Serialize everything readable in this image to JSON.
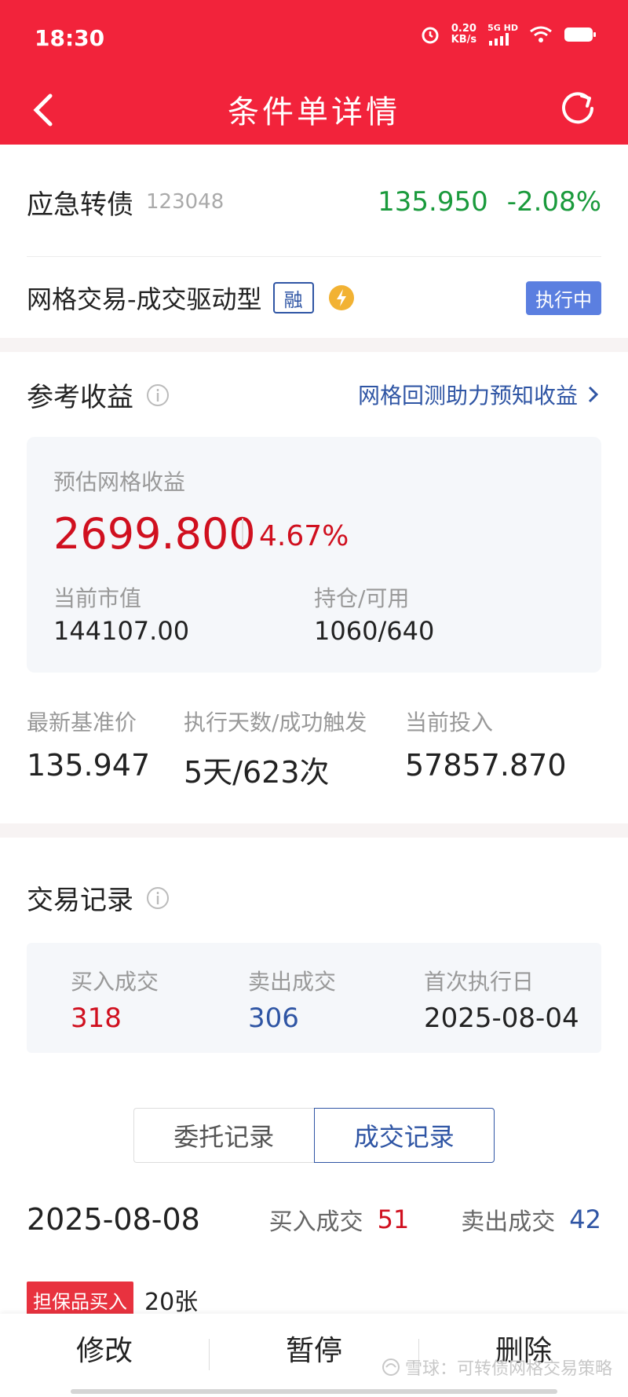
{
  "status_bar": {
    "time": "18:30",
    "net_speed": "0.20",
    "net_unit": "KB/s",
    "net_type": "5G HD",
    "icons": [
      "alarm-icon",
      "signal-icon",
      "wifi-icon",
      "battery-icon"
    ]
  },
  "nav": {
    "title": "条件单详情",
    "back_icon": "chevron-left-icon",
    "refresh_icon": "refresh-icon"
  },
  "bond": {
    "name": "应急转债",
    "code": "123048",
    "price": "135.950",
    "change": "-2.08%"
  },
  "strategy": {
    "name": "网格交易-成交驱动型",
    "margin_tag": "融",
    "status": "执行中"
  },
  "reference_profit": {
    "title": "参考收益",
    "backtest_link": "网格回测助力预知收益",
    "estimated_label": "预估网格收益",
    "estimated_amount": "2699.800",
    "estimated_rate": "4.67%",
    "market_value_label": "当前市值",
    "market_value": "144107.00",
    "holding_label": "持仓/可用",
    "holding": "1060/640"
  },
  "stats": {
    "base_price_label": "最新基准价",
    "base_price": "135.947",
    "days_label": "执行天数/成功触发",
    "days": "5天/623次",
    "investment_label": "当前投入",
    "investment": "57857.870"
  },
  "trade_records": {
    "title": "交易记录",
    "buy_label": "买入成交",
    "buy_count": "318",
    "sell_label": "卖出成交",
    "sell_count": "306",
    "first_date_label": "首次执行日",
    "first_date": "2025-08-04"
  },
  "tabs": [
    {
      "label": "委托记录",
      "active": false
    },
    {
      "label": "成交记录",
      "active": true
    }
  ],
  "day_summary": {
    "date": "2025-08-08",
    "buy_label": "买入成交",
    "buy_count": "51",
    "sell_label": "卖出成交",
    "sell_count": "42"
  },
  "record": {
    "tag": "担保品买入",
    "qty": "20张"
  },
  "bottom_bar": {
    "modify": "修改",
    "pause": "暂停",
    "delete": "删除",
    "watermark": "雪球：可转债网格交易策略"
  },
  "colors": {
    "header": "#f2233b",
    "up_red": "#d0101f",
    "down_green": "#1a9a3c",
    "link_blue": "#2f55a4",
    "badge_blue": "#5b7fe0"
  }
}
